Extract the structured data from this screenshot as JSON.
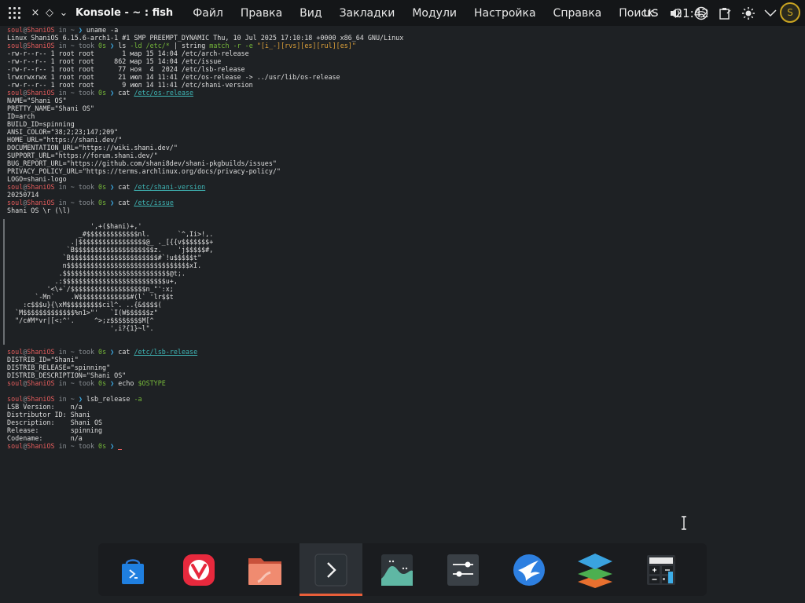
{
  "topbar": {
    "title": "Konsole - ~ : fish",
    "window_controls": [
      "×",
      "◇",
      "⌄"
    ],
    "menu": [
      "Файл",
      "Правка",
      "Вид",
      "Закладки",
      "Модули",
      "Настройка",
      "Справка",
      "Поиск"
    ],
    "clock": "21:42",
    "keyboard_layout": "us",
    "avatar_letter": "S",
    "tray_icons": [
      "volume-icon",
      "network-icon",
      "clipboard-icon",
      "brightness-icon",
      "expand-tray-icon"
    ]
  },
  "terminal": {
    "prompt": {
      "user": "soul",
      "at": "@",
      "host": "ShaniOS",
      "in": " in ",
      "dir": "~",
      "took": " took ",
      "time": "0s",
      "arrow": "❯"
    },
    "lines": [
      {
        "kind": "prompt",
        "took": false,
        "cmd": [
          {
            "t": "uname -a"
          }
        ]
      },
      {
        "kind": "out",
        "text": "Linux ShaniOS 6.15.6-arch1-1 #1 SMP PREEMPT_DYNAMIC Thu, 10 Jul 2025 17:10:18 +0000 x86_64 GNU/Linux"
      },
      {
        "kind": "prompt",
        "took": true,
        "cmd": [
          {
            "t": "ls "
          },
          {
            "t": "-ld /etc/*",
            "c": "t-var"
          },
          {
            "t": " | "
          },
          {
            "t": "string",
            "c": "t-plain"
          },
          {
            "t": " match -r -e ",
            "c": "t-var"
          },
          {
            "t": "\"[i_-][rvs][es][rul][es]\"",
            "c": "t-str"
          }
        ]
      },
      {
        "kind": "out",
        "text": "-rw-r--r-- 1 root root       1 мар 15 14:04 /etc/arch-release"
      },
      {
        "kind": "out",
        "text": "-rw-r--r-- 1 root root     862 мар 15 14:04 /etc/issue"
      },
      {
        "kind": "out",
        "text": "-rw-r--r-- 1 root root      77 ноя  4  2024 /etc/lsb-release"
      },
      {
        "kind": "out",
        "text": "lrwxrwxrwx 1 root root      21 июл 14 11:41 /etc/os-release -> ../usr/lib/os-release"
      },
      {
        "kind": "out",
        "text": "-rw-r--r-- 1 root root       9 июл 14 11:41 /etc/shani-version"
      },
      {
        "kind": "prompt",
        "took": true,
        "cmd": [
          {
            "t": "cat "
          },
          {
            "t": "/etc/os-release",
            "c": "t-link"
          }
        ]
      },
      {
        "kind": "out",
        "text": "NAME=\"Shani OS\""
      },
      {
        "kind": "out",
        "text": "PRETTY_NAME=\"Shani OS\""
      },
      {
        "kind": "out",
        "text": "ID=arch"
      },
      {
        "kind": "out",
        "text": "BUILD_ID=spinning"
      },
      {
        "kind": "out",
        "text": "ANSI_COLOR=\"38;2;23;147;209\""
      },
      {
        "kind": "out",
        "text": "HOME_URL=\"https://shani.dev/\""
      },
      {
        "kind": "out",
        "text": "DOCUMENTATION_URL=\"https://wiki.shani.dev/\""
      },
      {
        "kind": "out",
        "text": "SUPPORT_URL=\"https://forum.shani.dev/\""
      },
      {
        "kind": "out",
        "text": "BUG_REPORT_URL=\"https://github.com/shani8dev/shani-pkgbuilds/issues\""
      },
      {
        "kind": "out",
        "text": "PRIVACY_POLICY_URL=\"https://terms.archlinux.org/docs/privacy-policy/\""
      },
      {
        "kind": "out",
        "text": "LOGO=shani-logo"
      },
      {
        "kind": "prompt",
        "took": true,
        "cmd": [
          {
            "t": "cat "
          },
          {
            "t": "/etc/shani-version",
            "c": "t-link"
          }
        ]
      },
      {
        "kind": "out",
        "text": "20250714"
      },
      {
        "kind": "prompt",
        "took": true,
        "cmd": [
          {
            "t": "cat "
          },
          {
            "t": "/etc/issue",
            "c": "t-link"
          }
        ]
      },
      {
        "kind": "out",
        "text": "Shani OS \\r (\\l)"
      },
      {
        "kind": "out",
        "text": ""
      },
      {
        "kind": "out",
        "text": "                     ',+($hani)+,'"
      },
      {
        "kind": "out",
        "text": "                  _#$$$$$$$$$$$$$nl.       `^,Ii>!,."
      },
      {
        "kind": "out",
        "text": "                .|$$$$$$$$$$$$$$$$$@_ ._[{{v$$$$$$$+"
      },
      {
        "kind": "out",
        "text": "               `B$$$$$$$$$$$$$$$$$$$$z.    'j$$$$$#,"
      },
      {
        "kind": "out",
        "text": "              `B$$$$$$$$$$$$$$$$$$$$$$#`!u$$$$$t\""
      },
      {
        "kind": "out",
        "text": "              n$$$$$$$$$$$$$$$$$$$$$$$$$$$$$$$xI."
      },
      {
        "kind": "out",
        "text": "             .$$$$$$$$$$$$$$$$$$$$$$$$$$$@t;."
      },
      {
        "kind": "out",
        "text": "            .:$$$$$$$$$$$$$$$$$$$$$$$$$$u+,"
      },
      {
        "kind": "out",
        "text": "          '<\\+`/$$$$$$$$$$$$$$$$$$$n_\"':x;"
      },
      {
        "kind": "out",
        "text": "       `-Mn`    .W$$$$$$$$$$$$$#(l` 'lr$$t"
      },
      {
        "kind": "out",
        "text": "    :c$$$u}{\\xM$$$$$$$$$cil^. ..{&$$$$("
      },
      {
        "kind": "out",
        "text": "  `M$$$$$$$$$$$$$%n1>\"'   `I(W$$$$$$z\""
      },
      {
        "kind": "out",
        "text": "  \"/c#M*vr|[<:^'.     ^>;z$$$$$$$$M[^"
      },
      {
        "kind": "out",
        "text": "                          ',i?{1}~l\"."
      },
      {
        "kind": "out",
        "text": ""
      },
      {
        "kind": "out",
        "text": ""
      },
      {
        "kind": "prompt",
        "took": true,
        "cmd": [
          {
            "t": "cat "
          },
          {
            "t": "/etc/lsb-release",
            "c": "t-link"
          }
        ]
      },
      {
        "kind": "out",
        "text": "DISTRIB_ID=\"Shani\""
      },
      {
        "kind": "out",
        "text": "DISTRIB_RELEASE=\"spinning\""
      },
      {
        "kind": "out",
        "text": "DISTRIB_DESCRIPTION=\"Shani OS\""
      },
      {
        "kind": "prompt",
        "took": true,
        "cmd": [
          {
            "t": "echo "
          },
          {
            "t": "$OSTYPE",
            "c": "t-var"
          }
        ]
      },
      {
        "kind": "out",
        "text": ""
      },
      {
        "kind": "prompt",
        "took": false,
        "cmd": [
          {
            "t": "lsb_release "
          },
          {
            "t": "-a",
            "c": "t-var"
          }
        ]
      },
      {
        "kind": "out",
        "text": "LSB Version:    n/a"
      },
      {
        "kind": "out",
        "text": "Distributor ID: Shani"
      },
      {
        "kind": "out",
        "text": "Description:    Shani OS"
      },
      {
        "kind": "out",
        "text": "Release:        spinning"
      },
      {
        "kind": "out",
        "text": "Codename:       n/a"
      },
      {
        "kind": "prompt",
        "took": true,
        "cmd": [],
        "cursor": true
      }
    ]
  },
  "dock": {
    "items": [
      {
        "name": "store-app",
        "active": false
      },
      {
        "name": "vivaldi-browser",
        "active": false
      },
      {
        "name": "files-app",
        "active": false
      },
      {
        "name": "terminal-app",
        "active": true
      },
      {
        "name": "system-monitor-app",
        "active": false
      },
      {
        "name": "settings-app",
        "active": false
      },
      {
        "name": "web-app",
        "active": false
      },
      {
        "name": "layers-app",
        "active": false
      },
      {
        "name": "calculator-app",
        "active": false
      }
    ],
    "calculator_display": "0"
  },
  "colors": {
    "accent": "#e95f3a",
    "prompt_user": "#e25c5c",
    "link": "#3fb6b6",
    "string": "#e0a33a",
    "param": "#76b83a",
    "background": "#1e2124"
  }
}
